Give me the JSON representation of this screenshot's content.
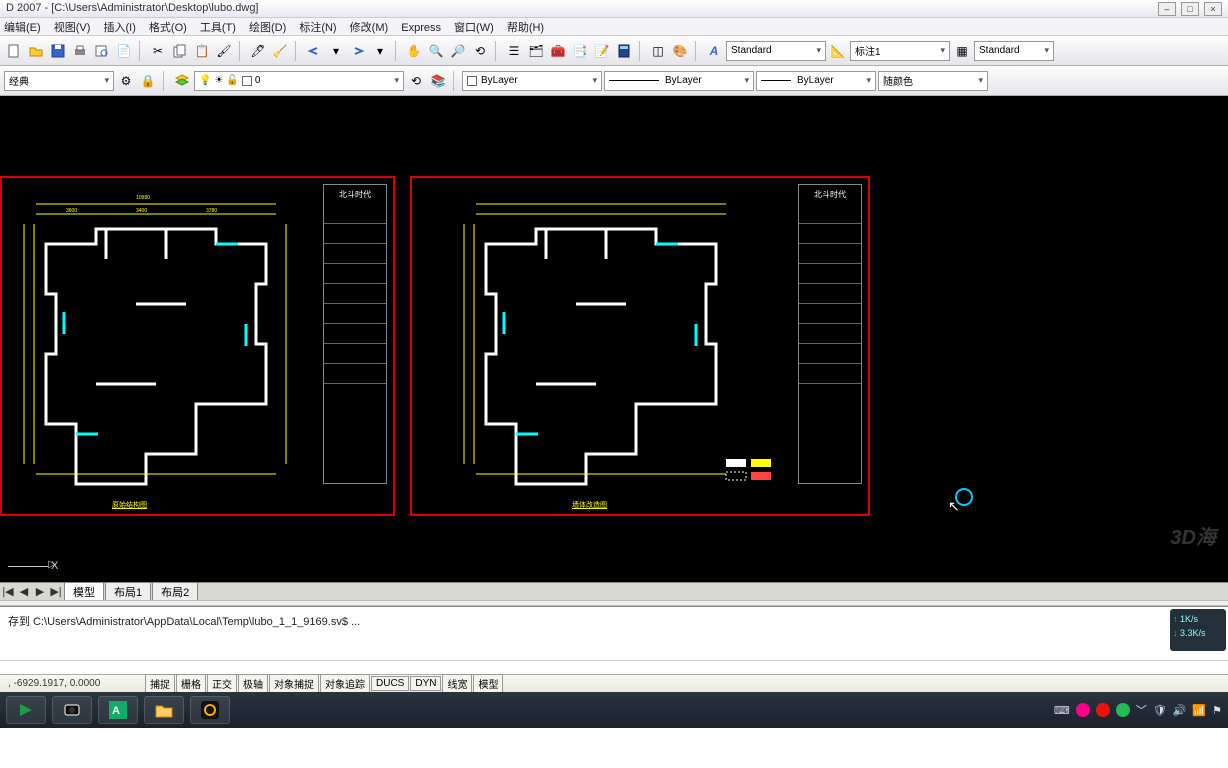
{
  "title": "D 2007 - [C:\\Users\\Administrator\\Desktop\\lubo.dwg]",
  "menu": [
    "编辑(E)",
    "视图(V)",
    "插入(I)",
    "格式(O)",
    "工具(T)",
    "绘图(D)",
    "标注(N)",
    "修改(M)",
    "Express",
    "窗口(W)",
    "帮助(H)"
  ],
  "toolbar1": {
    "style_dd": "Standard",
    "dim_dd": "标注1",
    "table_dd": "Standard"
  },
  "toolbar2": {
    "workspace": "经典",
    "layer_dd": "0",
    "color_dd": "ByLayer",
    "ltype_dd": "ByLayer",
    "lweight_dd": "ByLayer",
    "plotcolor": "随颜色"
  },
  "drawing": {
    "sheet_title": "北斗时代",
    "caption1": "原始结构图",
    "caption2": "墙体改造图"
  },
  "tabs": {
    "nav": [
      "|◀",
      "◀",
      "▶",
      "▶|"
    ],
    "items": [
      "模型",
      "布局1",
      "布局2"
    ],
    "active": 0
  },
  "cmd": {
    "line": "存到  C:\\Users\\Administrator\\AppData\\Local\\Temp\\lubo_1_1_9169.sv$ ..."
  },
  "net": {
    "up": "1K/s",
    "dn": "3.3K/s"
  },
  "status": {
    "coords": ", -6929.1917, 0.0000",
    "buttons": [
      "捕捉",
      "栅格",
      "正交",
      "极轴",
      "对象捕捉",
      "对象追踪",
      "DUCS",
      "DYN",
      "线宽",
      "模型"
    ]
  },
  "watermark": "3D海"
}
